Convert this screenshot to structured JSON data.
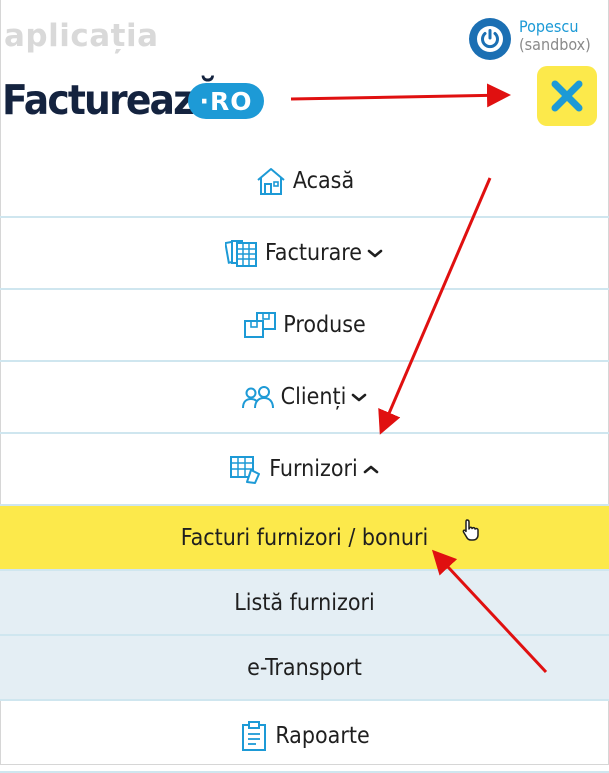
{
  "header": {
    "app_label": "aplicația",
    "logo_text": "FactureazĂ",
    "logo_badge": "·RO",
    "user_name": "Popescu",
    "user_mode": "(sandbox)"
  },
  "nav": {
    "items": [
      {
        "label": "Acasă",
        "icon": "home-icon"
      },
      {
        "label": "Facturare",
        "icon": "invoices-icon",
        "expanded": false
      },
      {
        "label": "Produse",
        "icon": "boxes-icon"
      },
      {
        "label": "Clienți",
        "icon": "users-icon",
        "expanded": false
      },
      {
        "label": "Furnizori",
        "icon": "suppliers-icon",
        "expanded": true
      }
    ],
    "sub_items": [
      {
        "label": "Facturi furnizori / bonuri",
        "active": true
      },
      {
        "label": "Listă furnizori",
        "active": false
      },
      {
        "label": "e-Transport",
        "active": false
      }
    ],
    "last_item": {
      "label": "Rapoarte",
      "icon": "clipboard-icon"
    }
  },
  "colors": {
    "accent_blue": "#1d9ad6",
    "highlight_yellow": "#fce94b",
    "annotation_red": "#e01010",
    "divider": "#cfe6ef",
    "submenu_bg": "#e4eef4"
  }
}
